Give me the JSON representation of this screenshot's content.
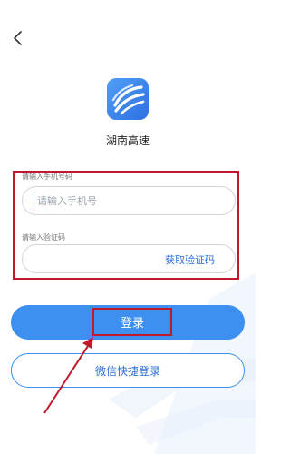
{
  "header": {
    "back_icon": "chevron-left-icon"
  },
  "app": {
    "name": "湖南高速",
    "logo_icon": "highway-logo-icon"
  },
  "form": {
    "phone_label": "请输入手机号码",
    "phone_placeholder": "请输入手机号",
    "code_label": "请输入验证码",
    "get_code_label": "获取验证码"
  },
  "actions": {
    "login_label": "登录",
    "wechat_login_label": "微信快捷登录"
  },
  "colors": {
    "primary": "#3d8ff0",
    "link": "#2a6fd6",
    "annotation": "#c0192b"
  }
}
